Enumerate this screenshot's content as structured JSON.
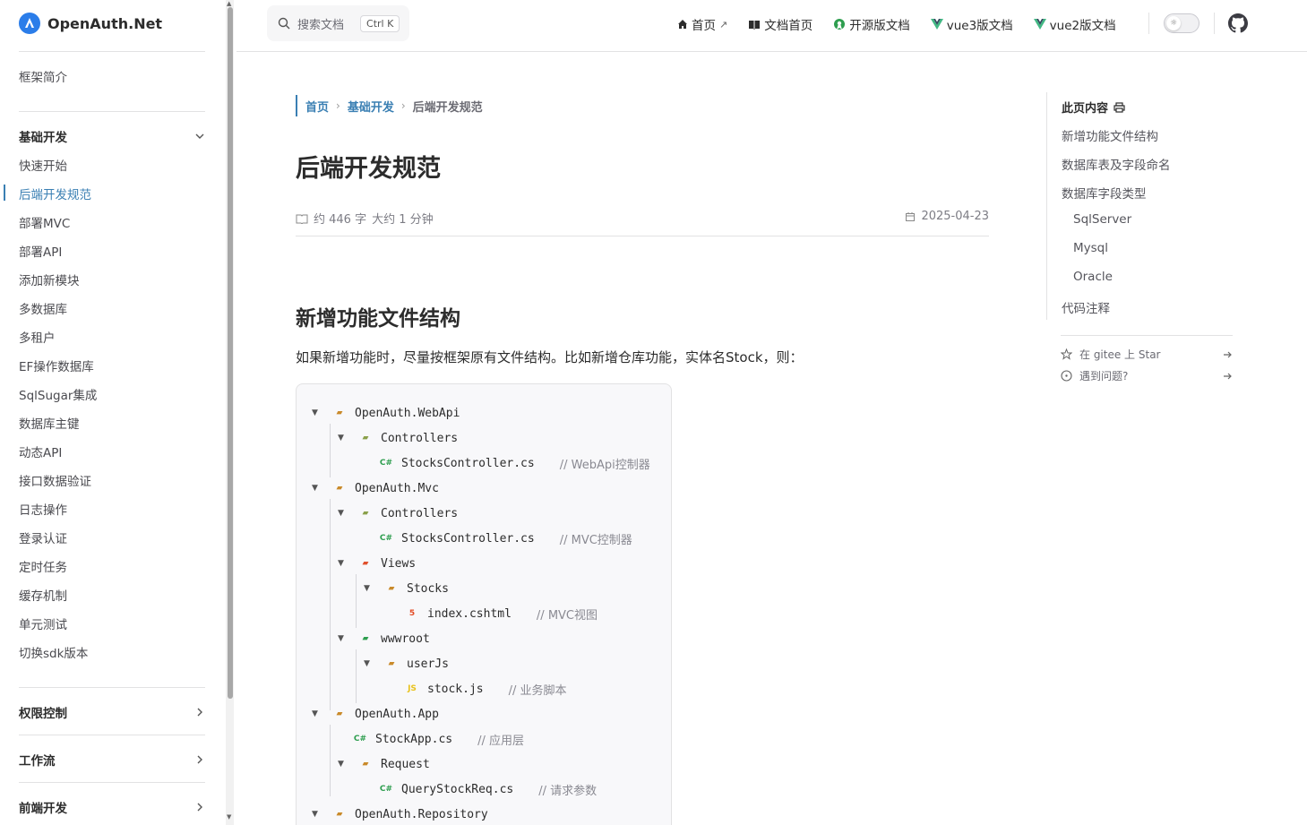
{
  "brand": {
    "name": "OpenAuth.Net",
    "color": "#2b7de9"
  },
  "accent": "#3a7fb3",
  "sidebar": {
    "intro": "框架简介",
    "group_basic": "基础开发",
    "items": [
      "快速开始",
      "后端开发规范",
      "部署MVC",
      "部署API",
      "添加新模块",
      "多数据库",
      "多租户",
      "EF操作数据库",
      "SqlSugar集成",
      "数据库主键",
      "动态API",
      "接口数据验证",
      "日志操作",
      "登录认证",
      "定时任务",
      "缓存机制",
      "单元测试",
      "切换sdk版本"
    ],
    "active_item": "后端开发规范",
    "group_permission": "权限控制",
    "group_workflow": "工作流",
    "group_frontend": "前端开发"
  },
  "search": {
    "placeholder": "搜索文档",
    "shortcut": "Ctrl K"
  },
  "nav": {
    "home": "首页",
    "home_ext": "↗",
    "docs_home": "文档首页",
    "oss_docs": "开源版文档",
    "vue3_docs": "vue3版文档",
    "vue2_docs": "vue2版文档"
  },
  "breadcrumb": {
    "home": "首页",
    "section": "基础开发",
    "current": "后端开发规范"
  },
  "page": {
    "title": "后端开发规范",
    "word_count": "约 446 字",
    "read_time": "大约 1 分钟",
    "date": "2025-04-23",
    "h2": "新增功能文件结构",
    "intro": "如果新增功能时，尽量按框架原有文件结构。比如新增仓库功能，实体名Stock，则："
  },
  "tree": [
    {
      "name": "OpenAuth.WebApi",
      "comment": ""
    },
    {
      "name": "Controllers",
      "comment": ""
    },
    {
      "name": "StocksController.cs",
      "comment": "// WebApi控制器"
    },
    {
      "name": "OpenAuth.Mvc",
      "comment": ""
    },
    {
      "name": "Controllers",
      "comment": ""
    },
    {
      "name": "StocksController.cs",
      "comment": "// MVC控制器"
    },
    {
      "name": "Views",
      "comment": ""
    },
    {
      "name": "Stocks",
      "comment": ""
    },
    {
      "name": "index.cshtml",
      "comment": "// MVC视图"
    },
    {
      "name": "wwwroot",
      "comment": ""
    },
    {
      "name": "userJs",
      "comment": ""
    },
    {
      "name": "stock.js",
      "comment": "// 业务脚本"
    },
    {
      "name": "OpenAuth.App",
      "comment": ""
    },
    {
      "name": "StockApp.cs",
      "comment": "// 应用层"
    },
    {
      "name": "Request",
      "comment": ""
    },
    {
      "name": "QueryStockReq.cs",
      "comment": "// 请求参数"
    },
    {
      "name": "OpenAuth.Repository",
      "comment": ""
    }
  ],
  "toc": {
    "title": "此页内容",
    "items": [
      "新增功能文件结构",
      "数据库表及字段命名",
      "数据库字段类型",
      "SqlServer",
      "Mysql",
      "Oracle",
      "代码注释"
    ],
    "gitee_star": "在 gitee 上 Star",
    "issue": "遇到问题?"
  }
}
